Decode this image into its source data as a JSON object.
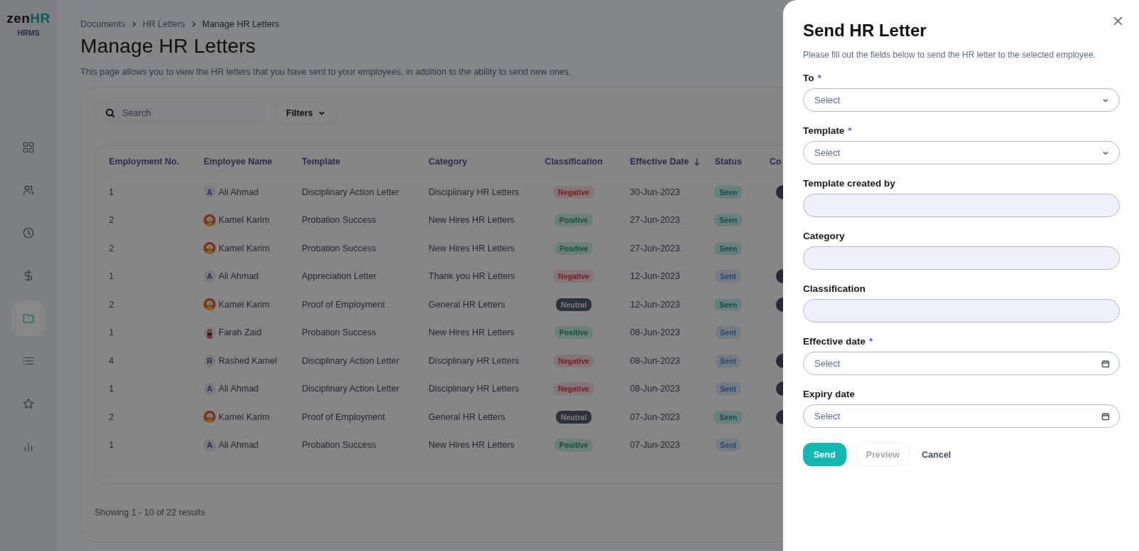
{
  "logo": {
    "prefix": "zen",
    "accent": "HR",
    "caption": "HRMS"
  },
  "sidebar": {
    "items": [
      {
        "selected": false
      },
      {
        "selected": false
      },
      {
        "selected": false
      },
      {
        "selected": false
      },
      {
        "selected": true
      },
      {
        "selected": false
      },
      {
        "selected": false
      },
      {
        "selected": false
      }
    ]
  },
  "breadcrumb": [
    {
      "label": "Documents",
      "current": false
    },
    {
      "label": "HR Letters",
      "current": false
    },
    {
      "label": "Manage HR Letters",
      "current": true
    }
  ],
  "page_title": "Manage HR Letters",
  "description": "This page allows you to view the HR letters that you have sent to your employees, in addition to the ability to send new ones.",
  "search": {
    "placeholder": "Search"
  },
  "filters_button": "Filters",
  "table": {
    "columns": [
      {
        "label": "Employment No."
      },
      {
        "label": "Employee Name"
      },
      {
        "label": "Template"
      },
      {
        "label": "Category"
      },
      {
        "label": "Classification"
      },
      {
        "label": "Effective Date",
        "sorted": true
      },
      {
        "label": "Status"
      },
      {
        "label": "Co"
      }
    ],
    "rows": [
      {
        "employment_no": "1",
        "employee": {
          "name": "Ali Ahmad",
          "avatar": {
            "kind": "initial",
            "letter": "A"
          }
        },
        "template": "Disciplinary Action Letter",
        "category": "Disciplinary HR Letters",
        "classification": {
          "label": "Negative",
          "kind": "negative"
        },
        "effective_date": "30-Jun-2023",
        "status": {
          "label": "Seen",
          "kind": "seen"
        },
        "column_8_pill": true
      },
      {
        "employment_no": "2",
        "employee": {
          "name": "Kamel Karim",
          "avatar": {
            "kind": "headdress_figure"
          }
        },
        "template": "Probation Success",
        "category": "New Hires HR Letters",
        "classification": {
          "label": "Positive",
          "kind": "positive"
        },
        "effective_date": "27-Jun-2023",
        "status": {
          "label": "Seen",
          "kind": "seen"
        },
        "column_8_pill": false
      },
      {
        "employment_no": "2",
        "employee": {
          "name": "Kamel Karim",
          "avatar": {
            "kind": "headdress_figure"
          }
        },
        "template": "Probation Success",
        "category": "New Hires HR Letters",
        "classification": {
          "label": "Positive",
          "kind": "positive"
        },
        "effective_date": "27-Jun-2023",
        "status": {
          "label": "Seen",
          "kind": "seen"
        },
        "column_8_pill": false
      },
      {
        "employment_no": "1",
        "employee": {
          "name": "Ali Ahmad",
          "avatar": {
            "kind": "initial",
            "letter": "A"
          }
        },
        "template": "Appreciation Letter",
        "category": "Thank you HR Letters",
        "classification": {
          "label": "Negative",
          "kind": "negative"
        },
        "effective_date": "12-Jun-2023",
        "status": {
          "label": "Sent",
          "kind": "sent"
        },
        "column_8_pill": true
      },
      {
        "employment_no": "2",
        "employee": {
          "name": "Kamel Karim",
          "avatar": {
            "kind": "headdress_figure"
          }
        },
        "template": "Proof of Employment",
        "category": "General HR Letters",
        "classification": {
          "label": "Neutral",
          "kind": "neutral"
        },
        "effective_date": "12-Jun-2023",
        "status": {
          "label": "Seen",
          "kind": "seen"
        },
        "column_8_pill": true
      },
      {
        "employment_no": "1",
        "employee": {
          "name": "Farah Zaid",
          "avatar": {
            "kind": "long_hair_figure"
          }
        },
        "template": "Probation Success",
        "category": "New Hires HR Letters",
        "classification": {
          "label": "Positive",
          "kind": "positive"
        },
        "effective_date": "08-Jun-2023",
        "status": {
          "label": "Sent",
          "kind": "sent"
        },
        "column_8_pill": false
      },
      {
        "employment_no": "4",
        "employee": {
          "name": "Rashed Kamel",
          "avatar": {
            "kind": "initial",
            "letter": "R"
          }
        },
        "template": "Disciplinary Action Letter",
        "category": "Disciplinary HR Letters",
        "classification": {
          "label": "Negative",
          "kind": "negative"
        },
        "effective_date": "08-Jun-2023",
        "status": {
          "label": "Sent",
          "kind": "sent"
        },
        "column_8_pill": true
      },
      {
        "employment_no": "1",
        "employee": {
          "name": "Ali Ahmad",
          "avatar": {
            "kind": "initial",
            "letter": "A"
          }
        },
        "template": "Disciplinary Action Letter",
        "category": "Disciplinary HR Letters",
        "classification": {
          "label": "Negative",
          "kind": "negative"
        },
        "effective_date": "08-Jun-2023",
        "status": {
          "label": "Sent",
          "kind": "sent"
        },
        "column_8_pill": true
      },
      {
        "employment_no": "2",
        "employee": {
          "name": "Kamel Karim",
          "avatar": {
            "kind": "headdress_figure"
          }
        },
        "template": "Proof of Employment",
        "category": "General HR Letters",
        "classification": {
          "label": "Neutral",
          "kind": "neutral"
        },
        "effective_date": "07-Jun-2023",
        "status": {
          "label": "Seen",
          "kind": "seen"
        },
        "column_8_pill": true
      },
      {
        "employment_no": "1",
        "employee": {
          "name": "Ali Ahmad",
          "avatar": {
            "kind": "initial",
            "letter": "A"
          }
        },
        "template": "Probation Success",
        "category": "New Hires HR Letters",
        "classification": {
          "label": "Positive",
          "kind": "positive"
        },
        "effective_date": "07-Jun-2023",
        "status": {
          "label": "Sent",
          "kind": "sent"
        },
        "column_8_pill": false
      }
    ]
  },
  "pagination_summary": "Showing 1 - 10 of 22 results",
  "drawer": {
    "title": "Send HR Letter",
    "subtitle": "Please fill out the fields below to send the HR letter to the selected employee.",
    "fields": [
      {
        "label": "To",
        "required_mark": "*",
        "kind": "select",
        "placeholder": "Select"
      },
      {
        "label": "Template",
        "required_mark": "*",
        "kind": "select",
        "placeholder": "Select"
      },
      {
        "label": "Template created by",
        "kind": "readonly"
      },
      {
        "label": "Category",
        "kind": "readonly"
      },
      {
        "label": "Classification",
        "kind": "readonly"
      },
      {
        "label": "Effective date",
        "required_mark": "*",
        "kind": "date",
        "placeholder": "Select"
      },
      {
        "label": "Expiry date",
        "kind": "date",
        "placeholder": "Select"
      }
    ],
    "buttons": [
      {
        "label": "Send",
        "kind": "primary",
        "disabled": false
      },
      {
        "label": "Preview",
        "kind": "outline",
        "disabled": true
      },
      {
        "label": "Cancel",
        "kind": "link",
        "disabled": false
      }
    ]
  }
}
